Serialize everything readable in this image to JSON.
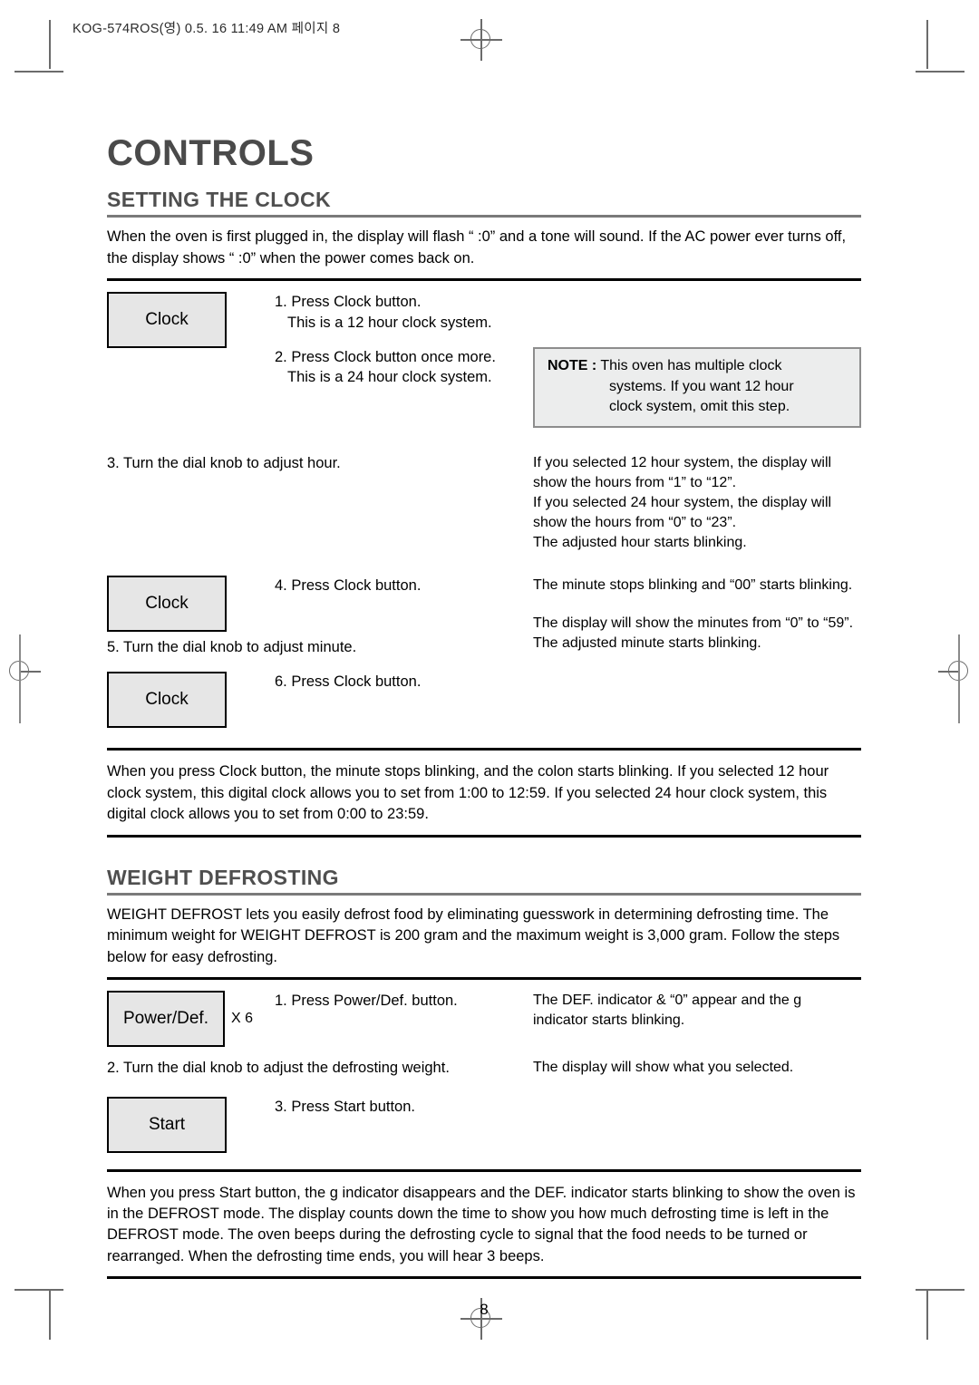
{
  "print_header": "KOG-574ROS(영) 0.5. 16 11:49 AM 페이지 8",
  "page_number": "8",
  "doc": {
    "title": "CONTROLS"
  },
  "clock_section": {
    "title": "SETTING THE CLOCK",
    "intro": "When the oven is first plugged in, the display will flash “ :0” and a tone will sound. If the AC power ever turns off, the display shows “ :0”  when the power comes back on.",
    "button_clock_label": "Clock",
    "steps": {
      "step1_main": "1. Press Clock button.",
      "step1_sub": "This is a 12 hour clock system.",
      "step2_main": "2. Press Clock button once more.",
      "step2_sub": "This is a 24 hour clock system.",
      "step3": "3. Turn the dial knob to adjust hour.",
      "step4": "4. Press Clock button.",
      "step5": "5. Turn the dial knob to adjust minute.",
      "step6": "6. Press Clock button."
    },
    "note": {
      "label": "NOTE :",
      "line1": " This oven has multiple clock",
      "line2": "systems. If you want 12 hour",
      "line3": "clock system, omit this step."
    },
    "results": {
      "hour_line1": "If you selected 12 hour system, the display will",
      "hour_line2": "show the hours from “1” to “12”.",
      "hour_line3": "If you selected 24 hour system, the display will",
      "hour_line4": "show the hours from “0” to “23”.",
      "hour_line5": "The adjusted hour starts blinking.",
      "minute_line1": "The minute stops blinking and “00” starts blinking.",
      "minute_line2": "The display will show the minutes from “0” to “59”.",
      "minute_line3": "The adjusted minute starts blinking."
    },
    "summary": "When you press Clock button, the minute stops blinking, and the colon starts blinking. If you selected 12 hour clock system, this digital clock allows you to set from 1:00 to 12:59. If you selected 24 hour clock system, this digital clock allows you to set from 0:00 to 23:59."
  },
  "defrost_section": {
    "title": "WEIGHT DEFROSTING",
    "intro": "WEIGHT DEFROST lets you easily defrost food by eliminating guesswork in determining defrosting time. The minimum weight for WEIGHT DEFROST is 200 gram and the maximum weight is 3,000 gram. Follow the steps below for easy defrosting.",
    "button_power_def_label": "Power/Def.",
    "button_power_def_multiplier": "X 6",
    "button_start_label": "Start",
    "steps": {
      "step1": "1. Press Power/Def. button.",
      "step2": "2. Turn the dial knob to adjust the defrosting weight.",
      "step3": "3. Press Start button."
    },
    "results": {
      "step1_line1": "The DEF. indicator & “0” appear and the g",
      "step1_line2": "indicator starts blinking.",
      "step2_line1": "The display will show what you selected."
    },
    "summary": "When you press Start button, the g indicator disappears and the DEF. indicator starts blinking to show the oven is in the DEFROST mode. The display counts down the time to show you how much defrosting time is left in the DEFROST mode. The oven beeps during the defrosting cycle to signal that the food needs to be turned or rearranged. When the defrosting time ends, you will hear 3 beeps."
  }
}
